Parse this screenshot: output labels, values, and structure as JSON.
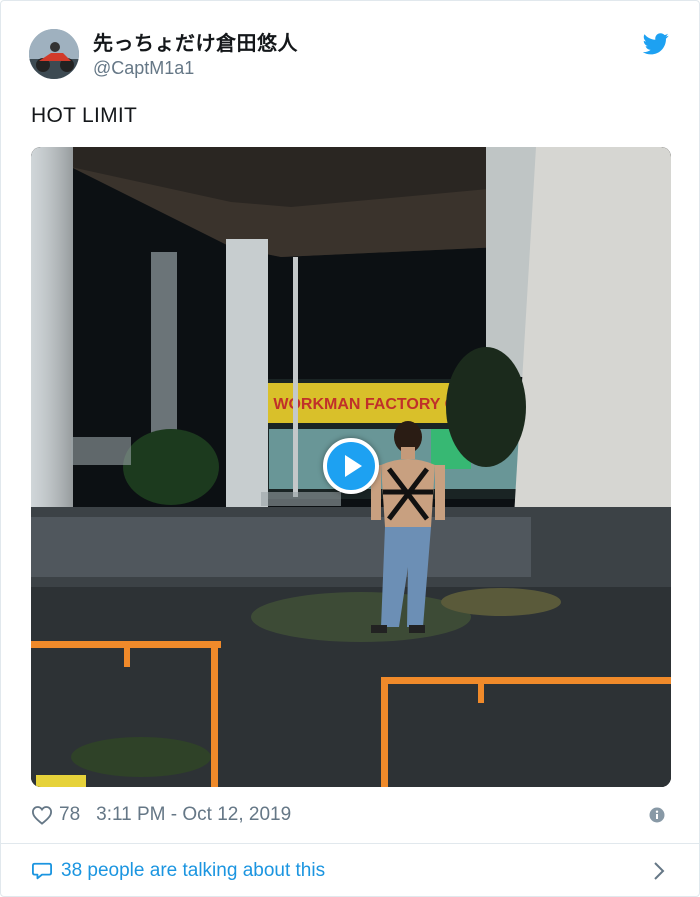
{
  "tweet": {
    "display_name": "先っちょだけ倉田悠人",
    "handle": "@CaptM1a1",
    "text": "HOT LIMIT",
    "like_count": "78",
    "timestamp": "3:11 PM - Oct 12, 2019",
    "talking_text": "38 people are talking about this"
  },
  "media": {
    "type": "video",
    "storefront_sign": "WORKMAN FACTORY OUTLET"
  },
  "icons": {
    "brand": "twitter-bird-icon",
    "like": "heart-icon",
    "info": "info-icon",
    "reply": "comment-icon",
    "expand": "chevron-right-icon",
    "play": "play-icon"
  },
  "colors": {
    "brand_blue": "#1da1f2",
    "link_blue": "#1b95e0",
    "secondary_text": "#657786",
    "border": "#e1e8ed"
  }
}
